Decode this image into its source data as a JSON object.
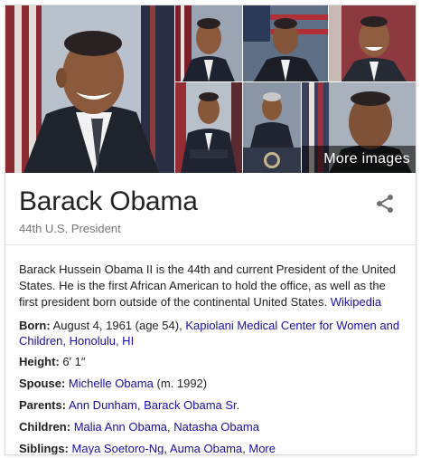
{
  "images": {
    "more_label": "More images"
  },
  "entity": {
    "name": "Barack Obama",
    "subtitle": "44th U.S. President"
  },
  "share_icon": "share-icon",
  "description": {
    "text": "Barack Hussein Obama II is the 44th and current President of the United States. He is the first African American to hold the office, as well as the first president born outside of the continental United States.",
    "source_link": "Wikipedia"
  },
  "facts": {
    "born": {
      "label": "Born:",
      "value": "August 4, 1961 (age 54),",
      "link": "Kapiolani Medical Center for Women and Children, Honolulu, HI"
    },
    "height": {
      "label": "Height:",
      "value": "6′ 1″"
    },
    "spouse": {
      "label": "Spouse:",
      "link": "Michelle Obama",
      "suffix": "(m. 1992)"
    },
    "parents": {
      "label": "Parents:",
      "links": [
        "Ann Dunham",
        "Barack Obama Sr."
      ]
    },
    "children": {
      "label": "Children:",
      "links": [
        "Malia Ann Obama",
        "Natasha Obama"
      ]
    },
    "siblings": {
      "label": "Siblings:",
      "links": [
        "Maya Soetoro-Ng",
        "Auma Obama",
        "More"
      ]
    }
  },
  "colors": {
    "link": "#1a0dab",
    "text": "#222222",
    "subtitle": "#777777",
    "divider": "#e6e6e6"
  }
}
